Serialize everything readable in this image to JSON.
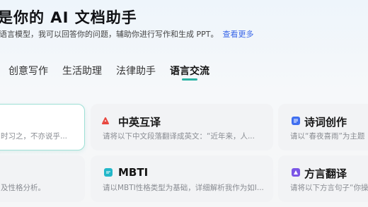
{
  "hero": {
    "title": "是你的 AI 文档助手",
    "subtitle": "语言模型，我可以回答你的问题，辅助你进行写作和生成 PPT。",
    "more_link": "查看更多"
  },
  "tabs": [
    {
      "label": "创意写作",
      "active": false
    },
    {
      "label": "生活助理",
      "active": false
    },
    {
      "label": "法律助手",
      "active": false
    },
    {
      "label": "语言交流",
      "active": true
    }
  ],
  "cards": [
    {
      "title": "",
      "desc": "时习之，不亦说乎..."
    },
    {
      "title": "中英互译",
      "desc": "请将以下中文段落翻译成英文：“近年来，人...",
      "icon": "pdf-icon",
      "icon_color": "#e8473f"
    },
    {
      "title": "诗词创作",
      "desc": "请以“春夜喜雨”为主题",
      "icon": "document-icon",
      "icon_color": "#3f6ef0"
    },
    {
      "title": "",
      "desc": "及性格分析。"
    },
    {
      "title": "MBTI",
      "desc": "请以MBTI性格类型为基础，详细解析我作为如I...",
      "icon": "chat-icon",
      "icon_color": "#23b7c9"
    },
    {
      "title": "方言翻译",
      "desc": "请将以下方言句子“你操",
      "icon": "dialect-icon",
      "icon_color": "#7b56e6"
    }
  ],
  "colors": {
    "accent": "#2bb3a4",
    "link": "#3a67e8",
    "card_bg": "#f2f3f5"
  }
}
